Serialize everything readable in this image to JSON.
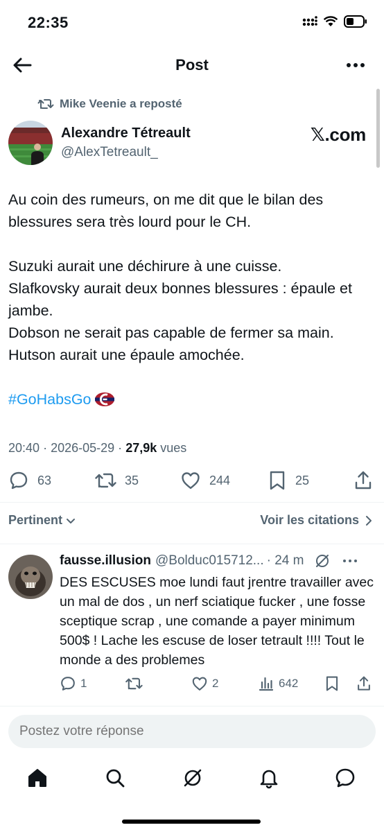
{
  "status_bar": {
    "time": "22:35"
  },
  "header": {
    "title": "Post"
  },
  "repost": {
    "text": "Mike Veenie a reposté"
  },
  "author": {
    "name": "Alexandre Tétreault",
    "handle": "@AlexTetreault_",
    "source": "𝕏.com"
  },
  "tweet": {
    "paragraphs": [
      "Au coin des rumeurs, on me dit que le bilan des blessures sera très lourd pour le CH.",
      "Suzuki aurait une déchirure à une cuisse.",
      "Slafkovsky aurait deux bonnes blessures : épaule et jambe.",
      "Dobson ne serait pas capable de fermer sa main.",
      "Hutson aurait une épaule amochée."
    ],
    "hashtag": "#GoHabsGo"
  },
  "meta": {
    "time": "20:40",
    "date": "2026-05-29",
    "separator": "·",
    "views_count": "27,9k",
    "views_label": "vues"
  },
  "actions": {
    "replies": "63",
    "reposts": "35",
    "likes": "244",
    "bookmarks": "25"
  },
  "sort": {
    "label": "Pertinent",
    "citations_label": "Voir les citations"
  },
  "reply": {
    "name": "fausse.illusion",
    "handle": "@Bolduc015712...",
    "time": "· 24 m",
    "text": "DES ESCUSES moe lundi faut jrentre travailler avec un mal de dos , un nerf sciatique fucker , une fosse sceptique scrap , une comande a payer minimum 500$ ! Lache les escuse de loser tetrault !!!! Tout le monde a des problemes",
    "replies": "1",
    "likes": "2",
    "views": "642"
  },
  "reply_input": {
    "placeholder": "Postez votre réponse"
  },
  "colors": {
    "accent": "#1d9bf0",
    "text": "#0f1419",
    "secondary": "#536471",
    "habs_red": "#af1e2d",
    "habs_blue": "#192168"
  }
}
